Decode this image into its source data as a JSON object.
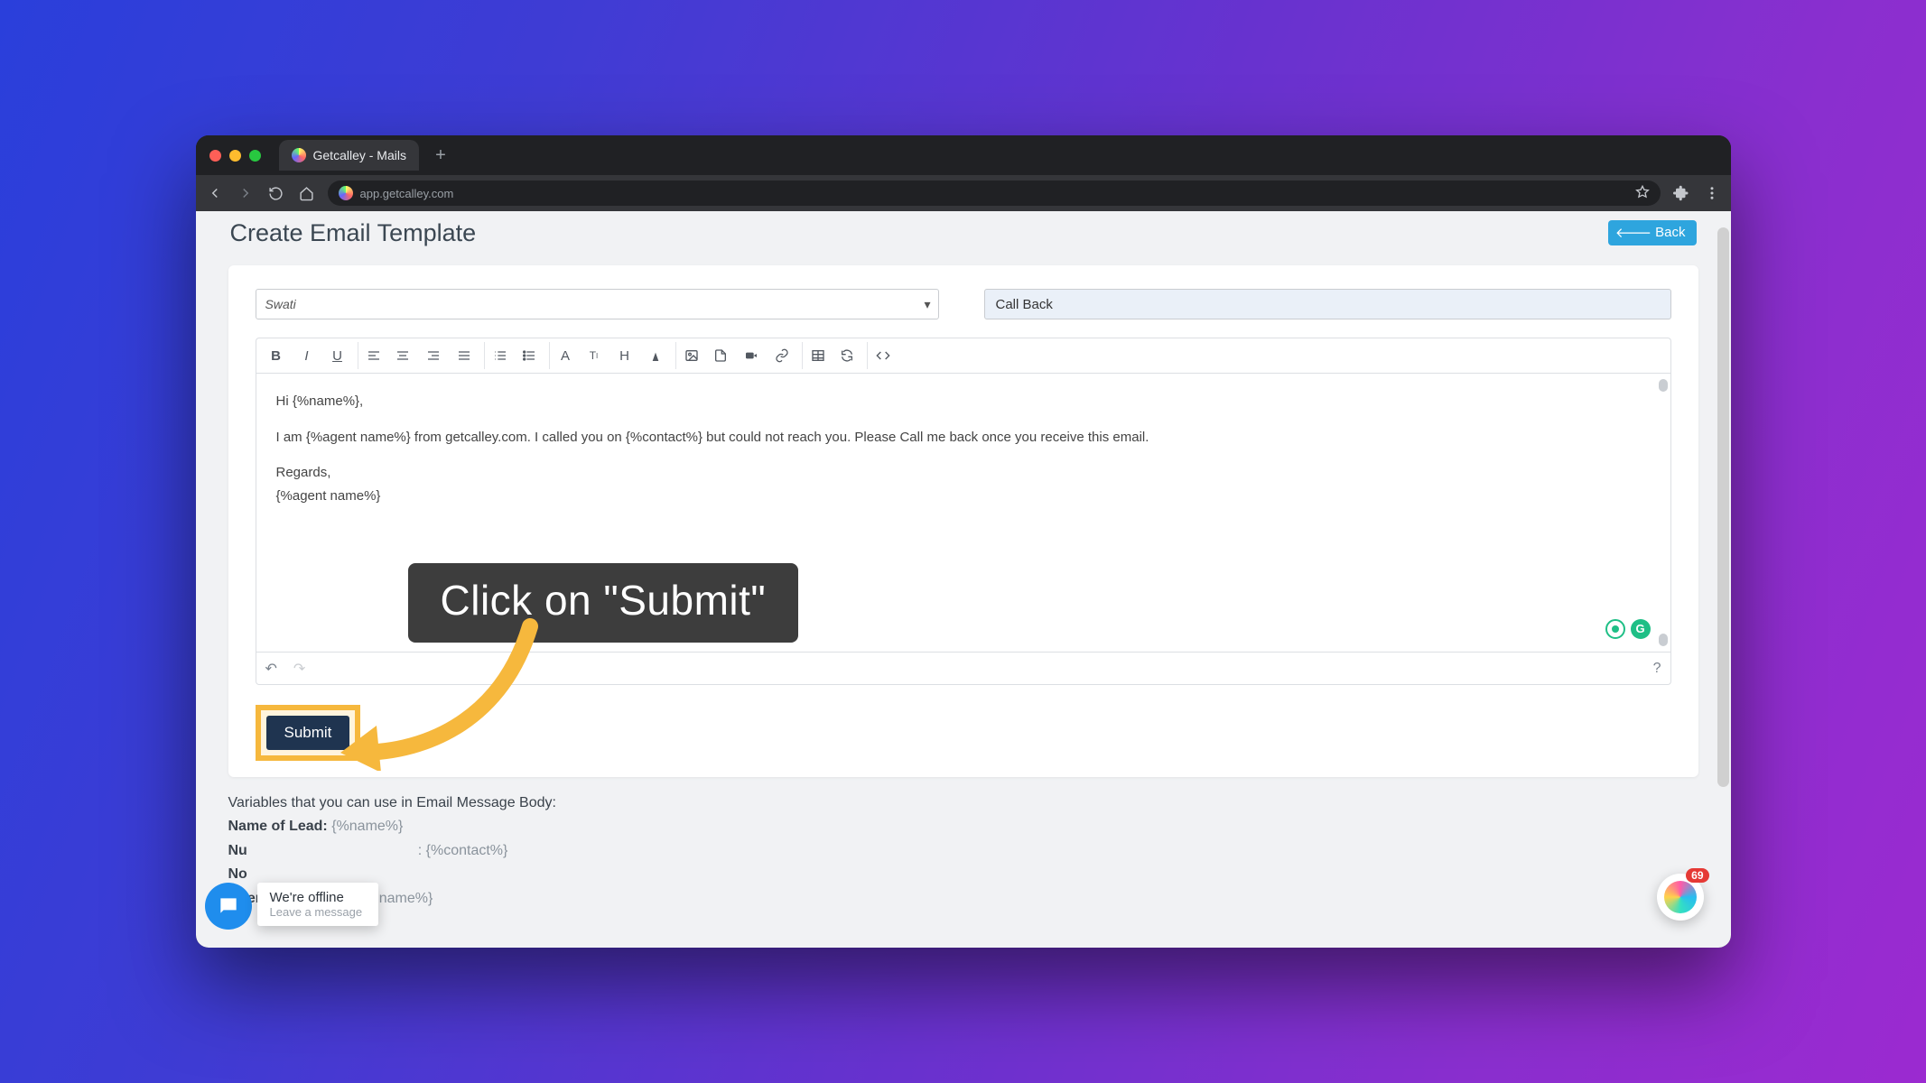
{
  "browser": {
    "tab_title": "Getcalley - Mails",
    "url": "app.getcalley.com"
  },
  "page": {
    "title": "Create Email Template",
    "back_label": "Back"
  },
  "form": {
    "agent_select": "Swati",
    "subject": "Call Back"
  },
  "editor": {
    "line1": "Hi {%name%},",
    "line2": "I am {%agent name%} from getcalley.com. I called you on {%contact%} but could not reach you. Please Call me back once you receive this email.",
    "line3": "Regards,",
    "line4": "{%agent name%}"
  },
  "submit_label": "Submit",
  "tooltip_text": "Click on \"Submit\"",
  "variables": {
    "heading": "Variables that you can use in Email Message Body:",
    "name_label": "Name of Lead:",
    "name_ph": "{%name%}",
    "contact_row_partial_left": "Nu",
    "contact_row_partial_right": ": {%contact%}",
    "notes_row": "No",
    "agent_label": "Agent Name:",
    "agent_ph": "{%agent name%}"
  },
  "chat": {
    "status": "We're offline",
    "sub": "Leave a message"
  },
  "notif_badge": "69",
  "toolbar_icons": [
    "B",
    "I",
    "U",
    "align-left",
    "align-center",
    "align-right",
    "align-justify",
    "list-ol",
    "list-ul",
    "font",
    "text-size",
    "heading",
    "color",
    "image",
    "file",
    "video",
    "link",
    "table",
    "refresh",
    "code"
  ],
  "footer_icons": {
    "undo": "↶",
    "redo": "↷",
    "help": "?"
  }
}
